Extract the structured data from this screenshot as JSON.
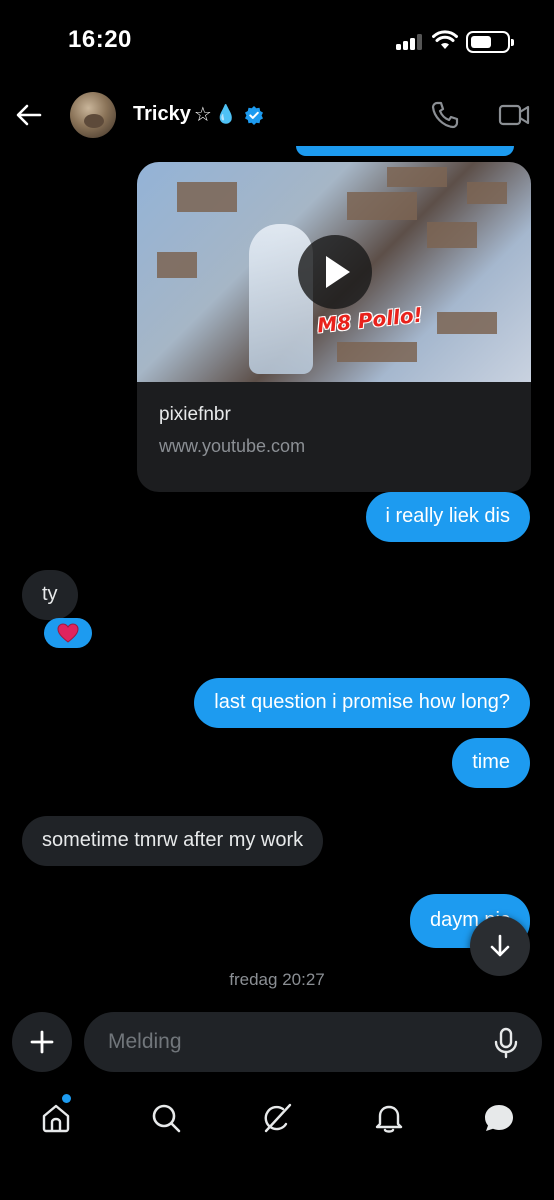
{
  "status_bar": {
    "time": "16:20"
  },
  "header": {
    "contact_name": "Tricky",
    "name_suffix": "☆",
    "name_emoji": "💧"
  },
  "link_card": {
    "title": "pixiefnbr",
    "url": "www.youtube.com",
    "thumbnail_text": "M8 Pollo!"
  },
  "messages": [
    {
      "direction": "out",
      "text": "i really liek dis"
    },
    {
      "direction": "in",
      "text": "ty",
      "reaction": "❤️"
    },
    {
      "direction": "out",
      "text": "last question i promise how long?"
    },
    {
      "direction": "out",
      "text": "time"
    },
    {
      "direction": "in",
      "text": "sometime tmrw after my work"
    },
    {
      "direction": "out",
      "text": "daym nic"
    }
  ],
  "timestamp": "fredag 20:27",
  "composer": {
    "placeholder": "Melding"
  },
  "icons": {
    "back": "arrow-left-icon",
    "call": "phone-icon",
    "video": "video-camera-icon",
    "add": "plus-icon",
    "mic": "microphone-icon",
    "scroll": "arrow-down-icon",
    "nav": [
      "home-icon",
      "search-icon",
      "grok-icon",
      "bell-icon",
      "messages-icon"
    ]
  },
  "colors": {
    "accent": "#1d9bf0",
    "incoming_bubble": "#202327",
    "background": "#000000"
  }
}
